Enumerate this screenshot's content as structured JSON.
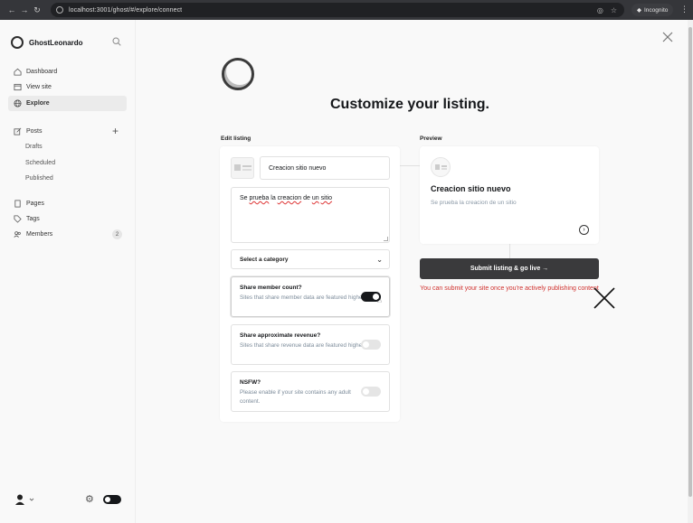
{
  "browser": {
    "url": "localhost:3001/ghost/#/explore/connect",
    "incognito_label": "Incognito"
  },
  "sidebar": {
    "site_name": "GhostLeonardo",
    "items": [
      {
        "label": "Dashboard",
        "icon": "home-icon"
      },
      {
        "label": "View site",
        "icon": "window-icon"
      },
      {
        "label": "Explore",
        "icon": "globe-icon",
        "active": true
      },
      {
        "label": "Posts",
        "icon": "edit-icon"
      },
      {
        "label": "Pages",
        "icon": "page-icon"
      },
      {
        "label": "Tags",
        "icon": "tag-icon"
      },
      {
        "label": "Members",
        "icon": "members-icon"
      }
    ],
    "post_subitems": [
      "Drafts",
      "Scheduled",
      "Published"
    ],
    "members_count": "2"
  },
  "main": {
    "title": "Customize your listing.",
    "edit_label": "Edit listing",
    "preview_label": "Preview",
    "site_title_value": "Creacion sitio nuevo",
    "description_value": {
      "w1": "Se ",
      "w2": "prueba",
      "w3": " la ",
      "w4": "creacion",
      "w5": " de ",
      "w6": "un",
      "w7": " ",
      "w8": "sitio"
    },
    "category_placeholder": "Select a category",
    "options": [
      {
        "title": "Share member count?",
        "desc": "Sites that share member data are featured higher",
        "on": true
      },
      {
        "title": "Share approximate revenue?",
        "desc": "Sites that share revenue data are featured higher",
        "on": false
      },
      {
        "title": "NSFW?",
        "desc": "Please enable if your site contains any adult content.",
        "on": false
      }
    ],
    "preview": {
      "title": "Creacion sitio nuevo",
      "desc": "Se prueba la creacion de un sitio"
    },
    "submit_label": "Submit listing & go live →",
    "warning": "You can submit your site once you're actively publishing content"
  },
  "colors": {
    "warning": "#d0302d",
    "submit_bg": "#3a3a3c",
    "toggle_on": "#15171a"
  }
}
